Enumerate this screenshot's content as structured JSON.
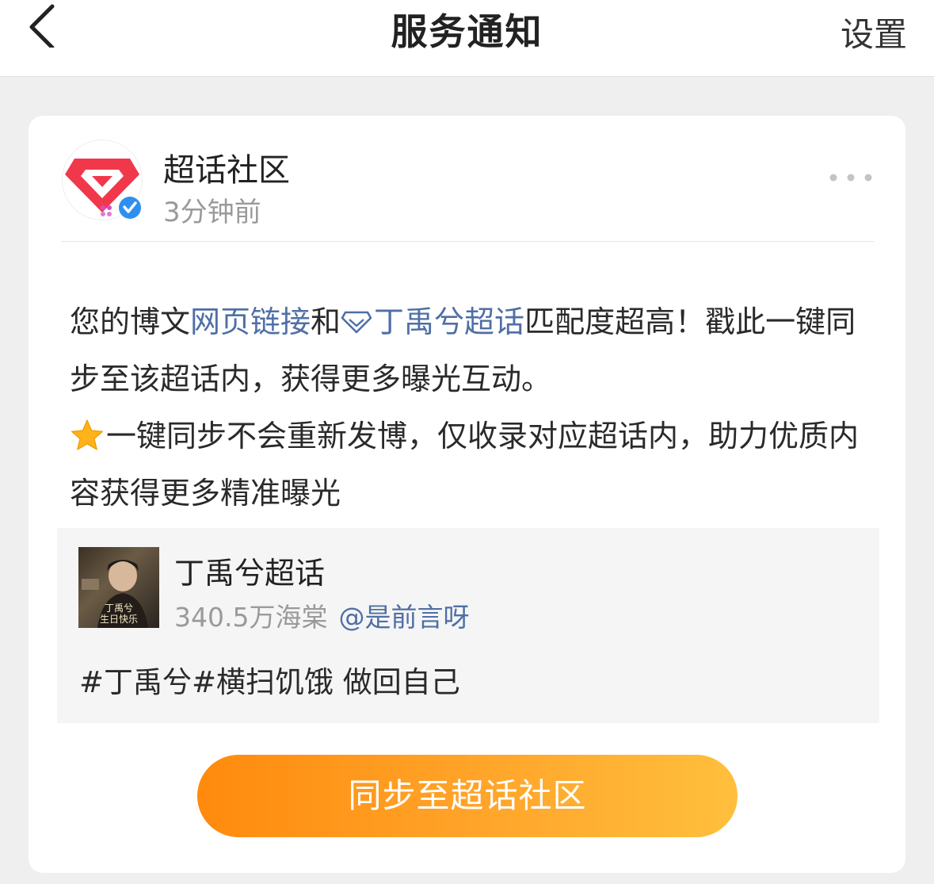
{
  "header": {
    "title": "服务通知",
    "settings_label": "设置"
  },
  "notification": {
    "sender": "超话社区",
    "time": "3分钟前",
    "message": {
      "part1": "您的博文",
      "link_webpage": "网页链接",
      "part2": "和",
      "link_topic": "丁禹兮超话",
      "part3": "匹配度超高！戳此一键同步至该超话内，获得更多曝光互动。",
      "part4": "一键同步不会重新发博，仅收录对应超话内，助力优质内容获得更多精准曝光"
    },
    "post": {
      "topic_name": "丁禹兮超话",
      "followers": "340.5万海棠",
      "username": "@是前言呀",
      "text": "#丁禹兮#横扫饥饿 做回自己",
      "thumb_line1": "丁禹兮",
      "thumb_line2": "生日快乐"
    },
    "button_label": "同步至超话社区"
  },
  "colors": {
    "accent_orange": "#ff9a1f",
    "link_blue": "#4f6fa6",
    "verified_blue": "#2f8ff0",
    "logo_red": "#f0384a"
  },
  "icons": {
    "back": "chevron-left-icon",
    "more": "more-dots-icon",
    "verified": "verified-check-icon",
    "topic": "diamond-icon",
    "star": "star-icon"
  }
}
